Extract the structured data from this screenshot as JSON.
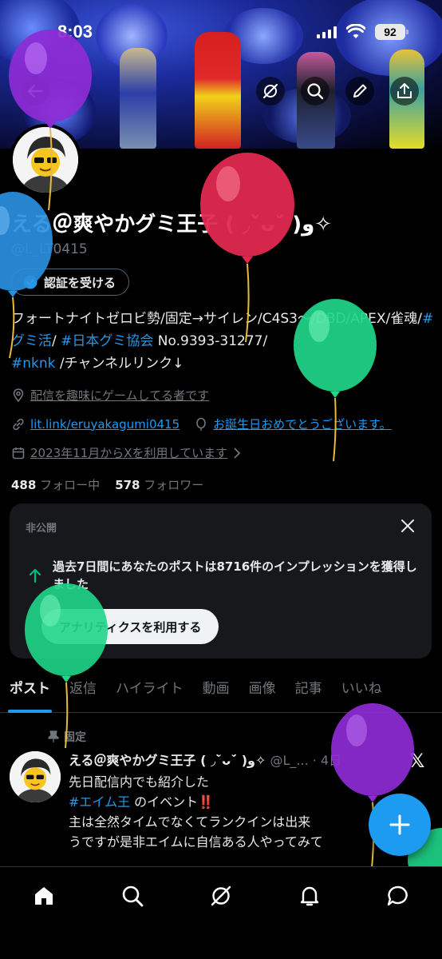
{
  "status_bar": {
    "time": "8:03",
    "battery": "92"
  },
  "header": {
    "back_icon": "back-arrow-icon",
    "icons": [
      "grok-icon",
      "search-icon",
      "edit-icon",
      "share-icon"
    ]
  },
  "profile": {
    "name": "える＠爽やかグミ王子 ( ◞˘̀ᴗ˘́ )و✧",
    "handle": "@L_LT0415",
    "verify_label": "認証を受ける",
    "bio_parts": [
      "フォートナイトゼロビ勢/固定→サイレン/C4S3〜/DBD/APEX/雀魂/",
      "#グミ活",
      "/ ",
      "#日本グミ協会",
      " No.9393-31277/",
      "#nknk",
      " /チャンネルリンク↓"
    ],
    "location": "配信を趣味にゲームしてる者です",
    "link": "lit.link/eruyakagumi0415",
    "birthday": "お誕生日おめでとうございます。",
    "joined": "2023年11月からXを利用しています",
    "following_count": "488",
    "following_label": "フォロー中",
    "followers_count": "578",
    "followers_label": "フォロワー"
  },
  "analytics_card": {
    "label": "非公開",
    "text": "過去7日間にあなたのポストは8716件のインプレッションを獲得しました",
    "button": "アナリティクスを利用する"
  },
  "tabs": [
    "ポスト",
    "返信",
    "ハイライト",
    "動画",
    "画像",
    "記事",
    "いいね"
  ],
  "pinned_post": {
    "pinned_label": "固定",
    "author": "える＠爽やかグミ王子 ( ◞˘̀ᴗ˘́ )و✧",
    "meta": "@L_... · 4日",
    "line1": "先日配信内でも紹介した",
    "hashtag": "#エイム王",
    "line2": " のイベント",
    "bang": "‼️",
    "line3": "主は全然タイムでなくてランクインは出来",
    "line4": "うですが是非エイムに自信ある人やってみて"
  },
  "bottom_nav": [
    "home-icon",
    "search-icon",
    "grok-icon",
    "notifications-icon",
    "messages-icon"
  ],
  "colors": {
    "accent": "#1d9bf0",
    "background": "#000000",
    "muted": "#71767b",
    "balloon_purple": "#8e2bd6",
    "balloon_red": "#e0284f",
    "balloon_green": "#1fd68a",
    "balloon_blue": "#2a8fe0"
  }
}
